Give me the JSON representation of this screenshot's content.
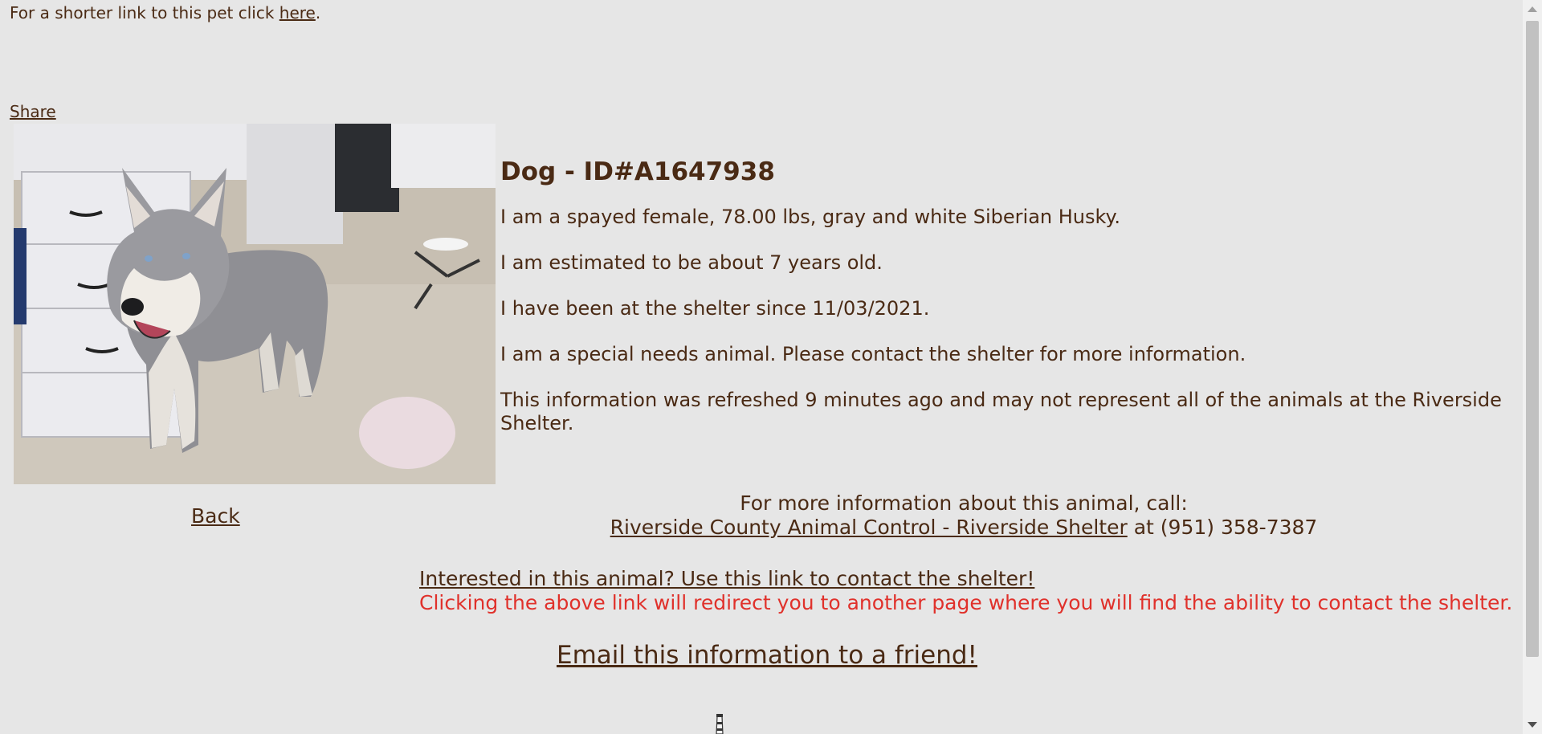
{
  "header": {
    "short_link_prefix": "For a shorter link to this pet click ",
    "short_link_label": "here",
    "short_link_suffix": ".",
    "share_label": "Share"
  },
  "pet": {
    "photo_alt": "Gray and white Siberian Husky",
    "title": "Dog - ID#A1647938",
    "description": "I am a spayed female, 78.00 lbs, gray and white Siberian Husky.",
    "age": "I am estimated to be about 7 years old.",
    "since": "I have been at the shelter since 11/03/2021.",
    "special_needs": "I am a special needs animal. Please contact the shelter for more information.",
    "refresh_note": "This information was refreshed 9 minutes ago and may not represent all of the animals at the Riverside Shelter."
  },
  "nav": {
    "back_label": "Back"
  },
  "contact": {
    "intro": "For more information about this animal, call:",
    "shelter_link": "Riverside County Animal Control - Riverside Shelter",
    "phone_text": " at (951) 358-7387"
  },
  "interest": {
    "link_label": "Interested in this animal? Use this link to contact the shelter!",
    "warning": "Clicking the above link will redirect you to another page where you will find the ability to contact the shelter."
  },
  "email": {
    "label": "Email this information to a friend!"
  },
  "colors": {
    "background": "#e6e6e6",
    "text": "#4a2a14",
    "warning": "#e0312b"
  },
  "icons": {
    "bottom": "lighthouse-icon"
  }
}
